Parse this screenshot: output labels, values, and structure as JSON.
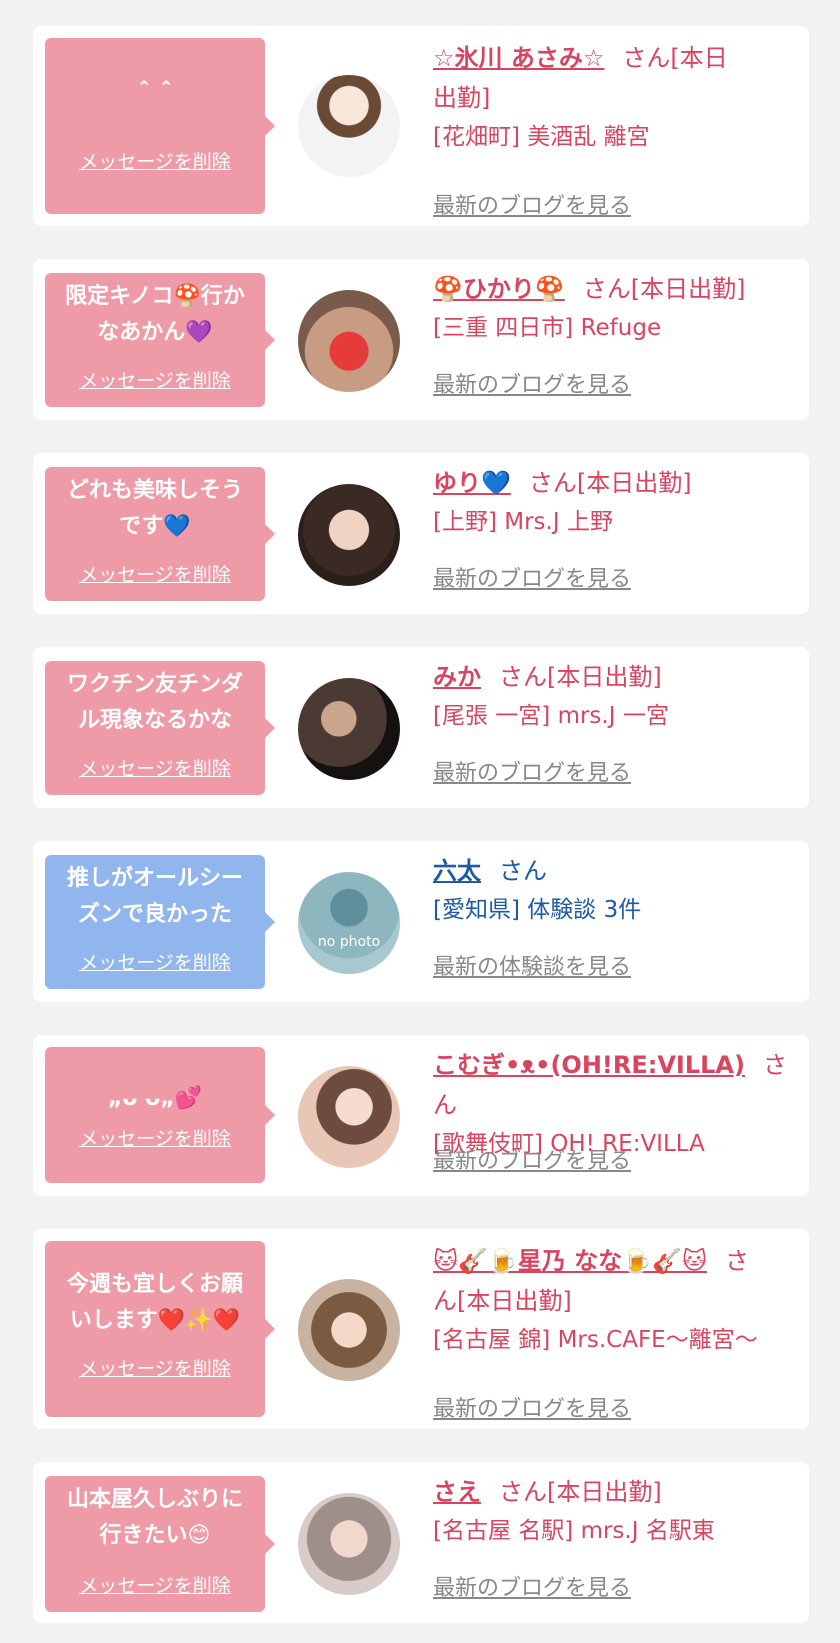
{
  "delete_label": "メッセージを削除",
  "cards": [
    {
      "message_lines": [
        "＾＾"
      ],
      "name": "☆氷川 あさみ☆",
      "suffix": "さん[本日",
      "suffix2": "出勤]",
      "shop": "[花畑町] 美酒乱 離宮",
      "link": "最新のブログを見る"
    },
    {
      "message_lines": [
        "限定キノコ🍄行か",
        "なあかん💜"
      ],
      "name": "🍄ひかり🍄",
      "suffix": "さん[本日出勤]",
      "shop": "[三重 四日市] Refuge",
      "link": "最新のブログを見る"
    },
    {
      "message_lines": [
        "どれも美味しそう",
        "です💙"
      ],
      "name": "ゆり💙",
      "suffix": "さん[本日出勤]",
      "shop": "[上野] Mrs.J 上野",
      "link": "最新のブログを見る"
    },
    {
      "message_lines": [
        "ワクチン友チンダ",
        "ル現象なるかな"
      ],
      "name": "みか",
      "suffix": "さん[本日出勤]",
      "shop": "[尾張 一宮] mrs.J 一宮",
      "link": "最新のブログを見る"
    },
    {
      "message_lines": [
        "推しがオールシー",
        "ズンで良かった"
      ],
      "name": "六太",
      "suffix": "さん",
      "shop": "[愛知県] 体験談 3件",
      "link": "最新の体験談を見る",
      "avatar_text": "no photo"
    },
    {
      "message_lines": [
        "„ᴗ ᴗ„💕"
      ],
      "name": "こむぎ•ᴥ•(OH!RE:VILLA)",
      "suffix": "さん",
      "shop": "[歌舞伎町] OH! RE:VILLA",
      "link": "最新のブログを見る"
    },
    {
      "message_lines": [
        "今週も宜しくお願",
        "いします❤️✨❤️"
      ],
      "name": "🐱🎸🍺星乃 なな🍺🎸🐱",
      "suffix": "さ",
      "suffix2": "ん[本日出勤]",
      "shop": "[名古屋 錦] Mrs.CAFE〜離宮〜",
      "link": "最新のブログを見る"
    },
    {
      "message_lines": [
        "山本屋久しぶりに",
        "行きたい😊"
      ],
      "name": "さえ",
      "suffix": "さん[本日出勤]",
      "shop": "[名古屋 名駅] mrs.J 名駅東",
      "link": "最新のブログを見る"
    }
  ]
}
